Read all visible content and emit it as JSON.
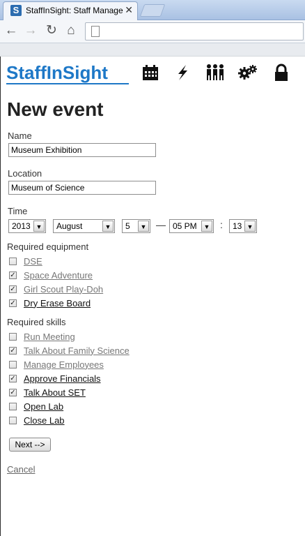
{
  "browser": {
    "tab_title": "StaffInSight: Staff Manage",
    "tab_close": "✕",
    "favicon_letter": "S",
    "back_icon": "←",
    "forward_icon": "→",
    "reload_icon": "↻",
    "home_icon": "⌂"
  },
  "app": {
    "logo_text": "StaffInSight",
    "nav_icons": [
      "calendar-icon",
      "lightning-icon",
      "people-icon",
      "gears-icon",
      "lock-icon"
    ]
  },
  "page_title": "New event",
  "form": {
    "name_label": "Name",
    "name_value": "Museum Exhibition",
    "location_label": "Location",
    "location_value": "Museum of Science",
    "time_label": "Time",
    "year": "2013",
    "month": "August",
    "day": "5",
    "dash": "—",
    "hour": "05 PM",
    "colon": ":",
    "minute": "13",
    "equipment_label": "Required equipment",
    "equipment": [
      {
        "label": "DSE",
        "checked": false
      },
      {
        "label": "Space Adventure",
        "checked": true
      },
      {
        "label": "Girl Scout Play-Doh",
        "checked": true
      },
      {
        "label": "Dry Erase Board",
        "checked": true
      }
    ],
    "skills_label": "Required skills",
    "skills": [
      {
        "label": "Run Meeting",
        "checked": false
      },
      {
        "label": "Talk About Family Science",
        "checked": true
      },
      {
        "label": "Manage Employees",
        "checked": false
      },
      {
        "label": "Approve Financials",
        "checked": true
      },
      {
        "label": "Talk About SET",
        "checked": true
      },
      {
        "label": "Open Lab",
        "checked": false
      },
      {
        "label": "Close Lab",
        "checked": false
      }
    ],
    "next_label": "Next -->",
    "cancel_label": "Cancel",
    "check_glyph": "✓",
    "arrow_glyph": "▼"
  },
  "colors": {
    "logo_blue": "#1e78c7"
  }
}
